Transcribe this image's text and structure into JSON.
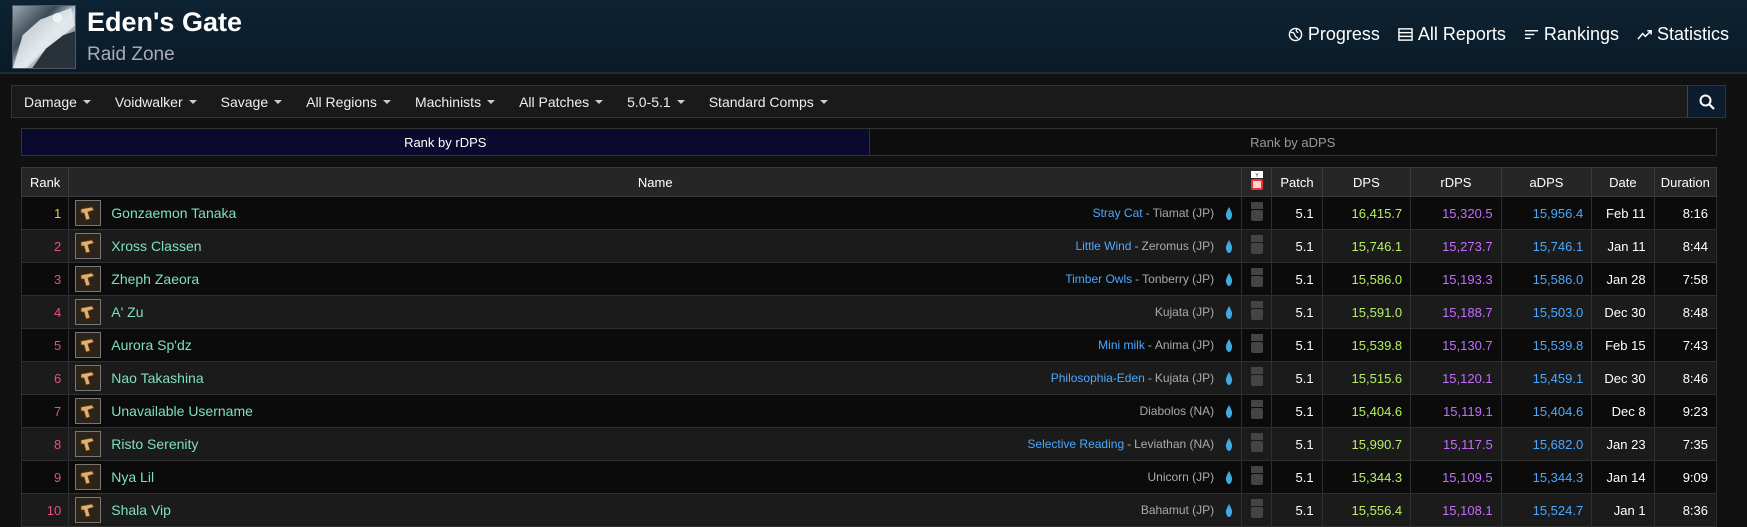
{
  "header": {
    "title": "Eden's Gate",
    "subtitle": "Raid Zone"
  },
  "topnav": [
    {
      "label": "Progress",
      "icon": "globe-icon"
    },
    {
      "label": "All Reports",
      "icon": "reports-icon"
    },
    {
      "label": "Rankings",
      "icon": "rankings-icon"
    },
    {
      "label": "Statistics",
      "icon": "statistics-icon"
    }
  ],
  "filters": [
    "Damage",
    "Voidwalker",
    "Savage",
    "All Regions",
    "Machinists",
    "All Patches",
    "5.0-5.1",
    "Standard Comps"
  ],
  "tabs": [
    "Rank by rDPS",
    "Rank by aDPS"
  ],
  "columns": {
    "rank": "Rank",
    "name": "Name",
    "patch": "Patch",
    "dps": "DPS",
    "rdps": "rDPS",
    "adps": "aDPS",
    "date": "Date",
    "duration": "Duration"
  },
  "rows": [
    {
      "rank": "1",
      "name": "Gonzaemon Tanaka",
      "guild": "Stray Cat",
      "server": "Tiamat (JP)",
      "patch": "5.1",
      "dps": "16,415.7",
      "rdps": "15,320.5",
      "adps": "15,956.4",
      "date": "Feb 11",
      "duration": "8:16"
    },
    {
      "rank": "2",
      "name": "Xross Classen",
      "guild": "Little Wind",
      "server": "Zeromus (JP)",
      "patch": "5.1",
      "dps": "15,746.1",
      "rdps": "15,273.7",
      "adps": "15,746.1",
      "date": "Jan 11",
      "duration": "8:44"
    },
    {
      "rank": "3",
      "name": "Zheph Zaeora",
      "guild": "Timber Owls",
      "server": "Tonberry (JP)",
      "patch": "5.1",
      "dps": "15,586.0",
      "rdps": "15,193.3",
      "adps": "15,586.0",
      "date": "Jan 28",
      "duration": "7:58"
    },
    {
      "rank": "4",
      "name": "A' Zu",
      "guild": "",
      "server": "Kujata (JP)",
      "patch": "5.1",
      "dps": "15,591.0",
      "rdps": "15,188.7",
      "adps": "15,503.0",
      "date": "Dec 30",
      "duration": "8:48"
    },
    {
      "rank": "5",
      "name": "Aurora Sp'dz",
      "guild": "Mini milk",
      "server": "Anima (JP)",
      "patch": "5.1",
      "dps": "15,539.8",
      "rdps": "15,130.7",
      "adps": "15,539.8",
      "date": "Feb 15",
      "duration": "7:43"
    },
    {
      "rank": "6",
      "name": "Nao Takashina",
      "guild": "Philosophia-Eden",
      "server": "Kujata (JP)",
      "patch": "5.1",
      "dps": "15,515.6",
      "rdps": "15,120.1",
      "adps": "15,459.1",
      "date": "Dec 30",
      "duration": "8:46"
    },
    {
      "rank": "7",
      "name": "Unavailable Username",
      "guild": "",
      "server": "Diabolos (NA)",
      "patch": "5.1",
      "dps": "15,404.6",
      "rdps": "15,119.1",
      "adps": "15,404.6",
      "date": "Dec 8",
      "duration": "9:23"
    },
    {
      "rank": "8",
      "name": "Risto Serenity",
      "guild": "Selective Reading",
      "server": "Leviathan (NA)",
      "patch": "5.1",
      "dps": "15,990.7",
      "rdps": "15,117.5",
      "adps": "15,682.0",
      "date": "Jan 23",
      "duration": "7:35"
    },
    {
      "rank": "9",
      "name": "Nya Lil",
      "guild": "",
      "server": "Unicorn (JP)",
      "patch": "5.1",
      "dps": "15,344.3",
      "rdps": "15,109.5",
      "adps": "15,344.3",
      "date": "Jan 14",
      "duration": "9:09"
    },
    {
      "rank": "10",
      "name": "Shala Vip",
      "guild": "",
      "server": "Bahamut (JP)",
      "patch": "5.1",
      "dps": "15,556.4",
      "rdps": "15,108.1",
      "adps": "15,524.7",
      "date": "Jan 1",
      "duration": "8:36"
    }
  ]
}
